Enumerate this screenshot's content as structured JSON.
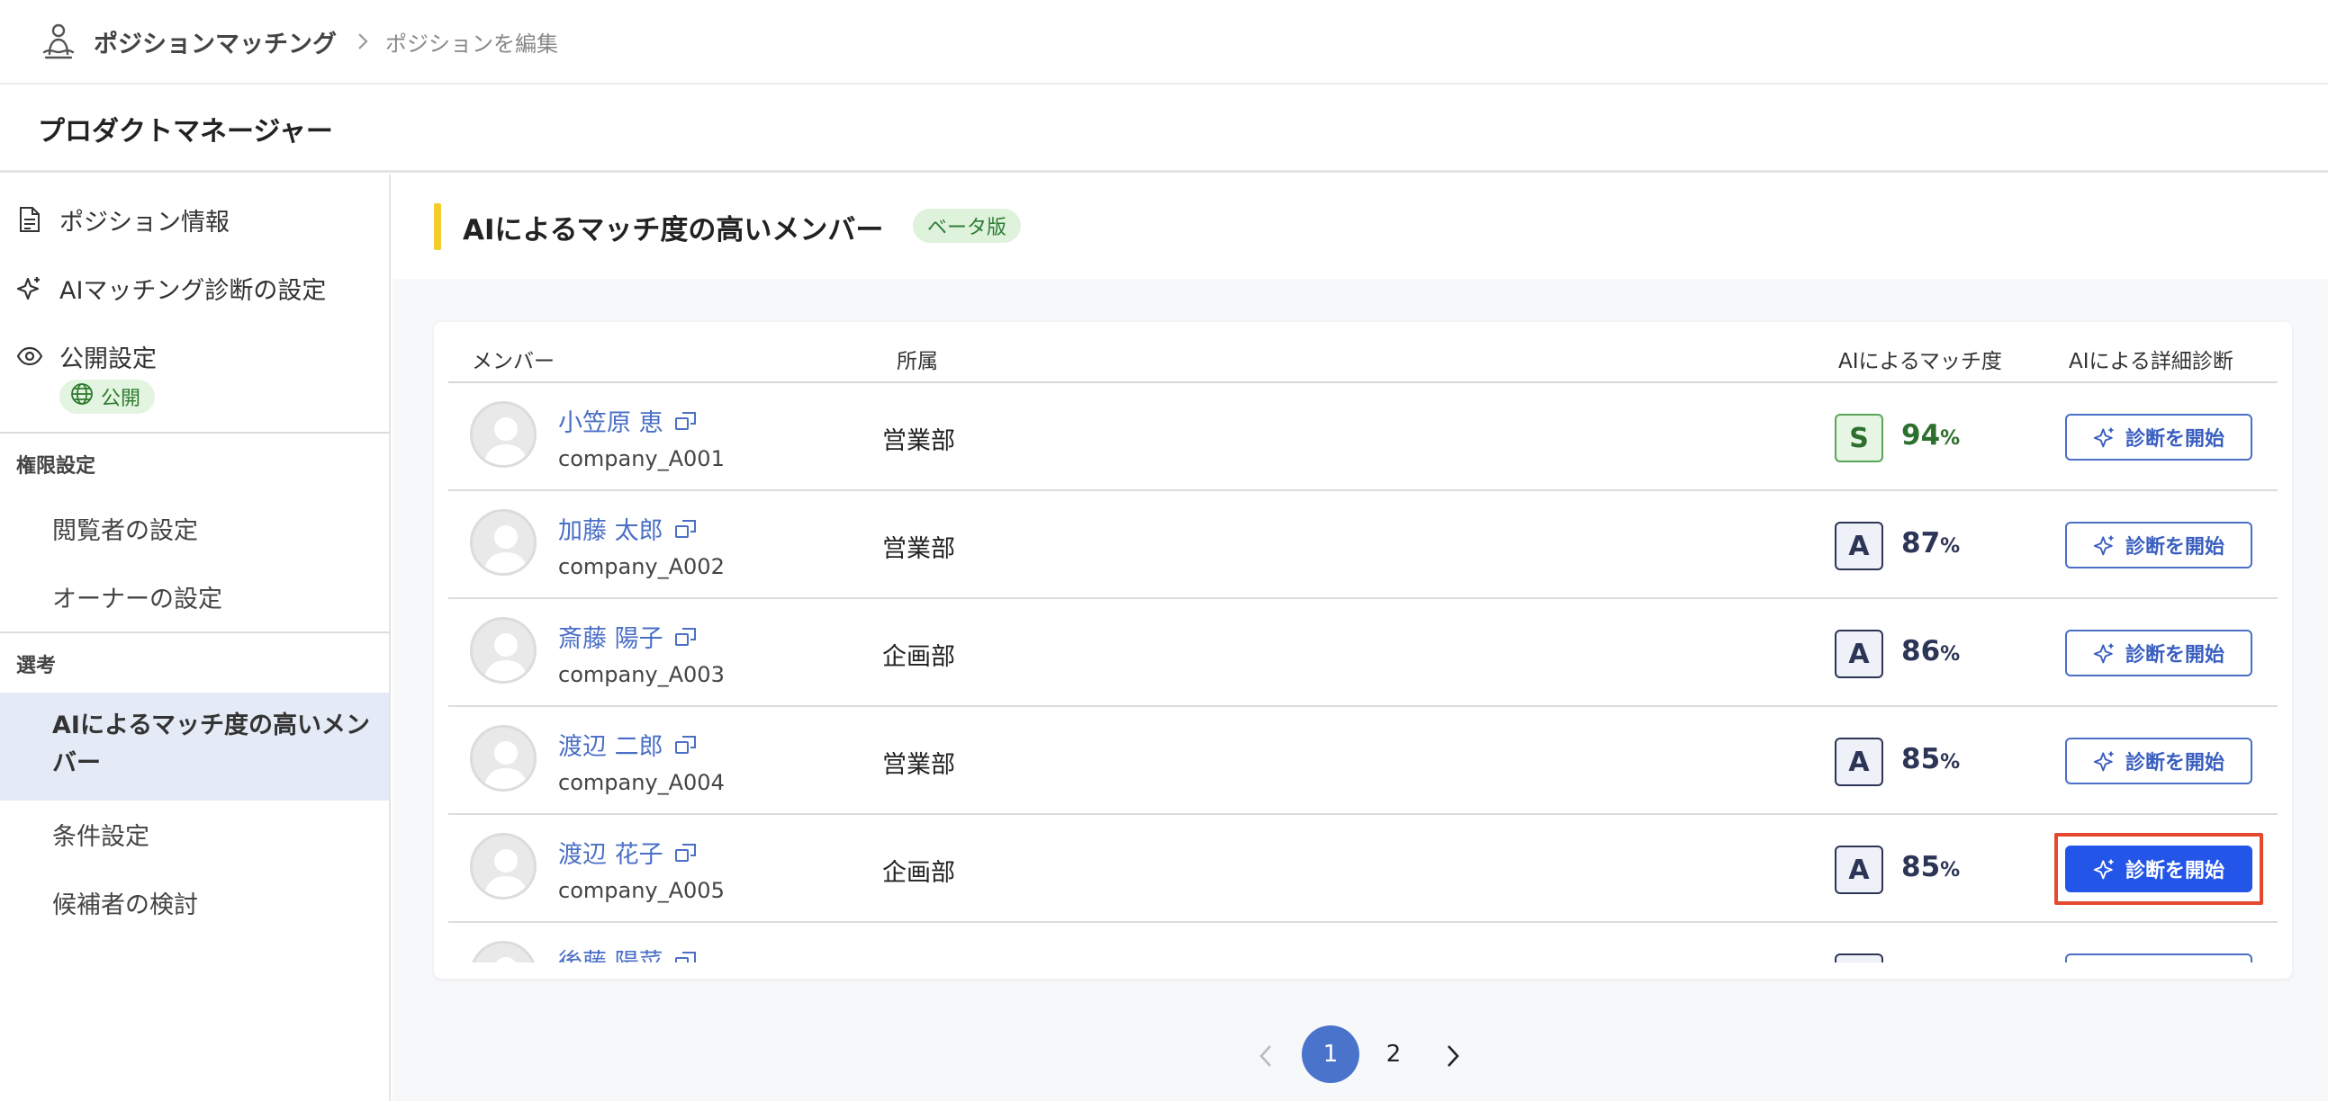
{
  "header": {
    "app_name": "ポジションマッチング",
    "breadcrumb_current": "ポジションを編集"
  },
  "page": {
    "title": "プロダクトマネージャー"
  },
  "sidebar": {
    "position_info": "ポジション情報",
    "ai_matching_settings": "AIマッチング診断の設定",
    "publish_settings": "公開設定",
    "publish_badge": "公開",
    "permissions_section": "権限設定",
    "viewer_settings": "閲覧者の設定",
    "owner_settings": "オーナーの設定",
    "selection_section": "選考",
    "ai_high_match": "AIによるマッチ度の高いメンバー",
    "conditions": "条件設定",
    "candidate_review": "候補者の検討"
  },
  "main": {
    "section_title": "AIによるマッチ度の高いメンバー",
    "beta_badge": "ベータ版",
    "columns": {
      "member": "メンバー",
      "department": "所属",
      "match": "AIによるマッチ度",
      "diagnosis": "AIによる詳細診断"
    },
    "percent_unit": "%",
    "diag_button": "診断を開始",
    "rows": [
      {
        "name": "小笠原 恵",
        "id": "company_A001",
        "dept": "営業部",
        "grade": "S",
        "pct": "94"
      },
      {
        "name": "加藤 太郎",
        "id": "company_A002",
        "dept": "営業部",
        "grade": "A",
        "pct": "87"
      },
      {
        "name": "斎藤 陽子",
        "id": "company_A003",
        "dept": "企画部",
        "grade": "A",
        "pct": "86"
      },
      {
        "name": "渡辺 二郎",
        "id": "company_A004",
        "dept": "営業部",
        "grade": "A",
        "pct": "85"
      },
      {
        "name": "渡辺 花子",
        "id": "company_A005",
        "dept": "企画部",
        "grade": "A",
        "pct": "85"
      },
      {
        "name": "後藤 陽菜",
        "id": "",
        "dept": "",
        "grade": "",
        "pct": ""
      }
    ]
  },
  "pagination": {
    "page1": "1",
    "page2": "2"
  },
  "colors": {
    "accent": "#4a6fc5",
    "primary_button": "#2356e8",
    "highlight": "#f4cd2a"
  }
}
